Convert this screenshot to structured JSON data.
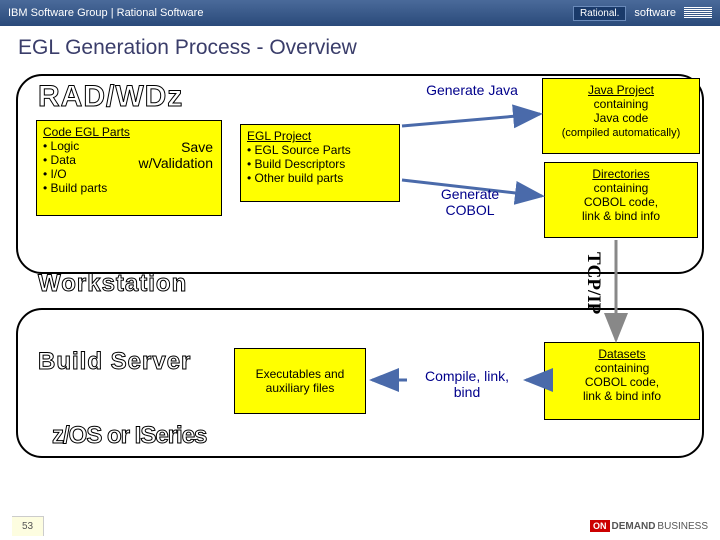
{
  "topbar": {
    "crumb": "IBM Software Group | Rational Software",
    "badge": "Rational.",
    "sw": "software"
  },
  "title": "EGL Generation Process -  Overview",
  "labels": {
    "radwdz": "RAD/WDz",
    "workstation": "Workstation",
    "buildserver": "Build Server",
    "zos": "z/OS or ISeries"
  },
  "box1": {
    "heading": "Code EGL Parts",
    "l1": "• Logic",
    "l2": "• Data",
    "l3": "• I/O",
    "l4": "• Build parts",
    "save1": "Save",
    "save2": "w/Validation"
  },
  "box2": {
    "heading": "EGL Project",
    "l1": "• EGL Source Parts",
    "l2": "• Build Descriptors",
    "l3": "• Other build parts"
  },
  "box3": {
    "l1": "Java Project",
    "l2": "containing",
    "l3": "Java code",
    "l4": "(compiled automatically)"
  },
  "box4": {
    "l1": "Directories",
    "l2": "containing",
    "l3": "COBOL code,",
    "l4": "link & bind info"
  },
  "box5": {
    "l1": "Executables and auxiliary files"
  },
  "box6": {
    "l1": "Datasets",
    "l2": "containing",
    "l3": "COBOL code,",
    "l4": "link & bind info"
  },
  "arrows": {
    "genjava": "Generate Java",
    "gencobol": "Generate COBOL",
    "compile": "Compile, link, bind",
    "tcpip": "TCP/IP"
  },
  "footer": {
    "page": "53",
    "on": "ON",
    "demand": "DEMAND",
    "biz": "BUSINESS"
  }
}
